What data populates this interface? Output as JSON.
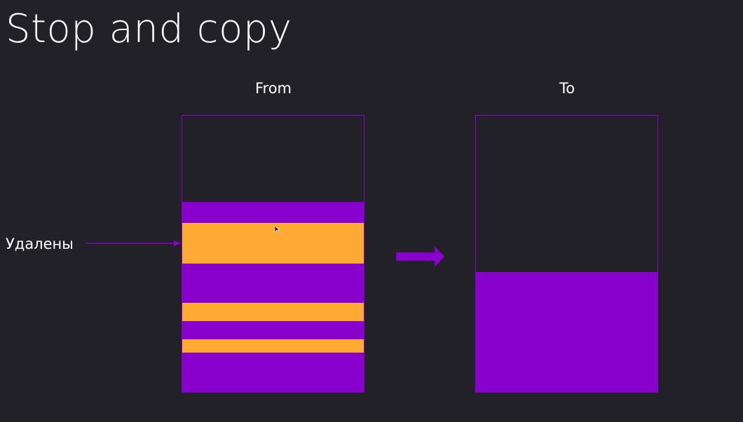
{
  "title": "Stop and copy",
  "from_label": "From",
  "to_label": "To",
  "deleted_label": "Удалены",
  "colors": {
    "background": "#232128",
    "live": "#8800cc",
    "garbage": "#ffaa33",
    "border": "#8a00d6"
  }
}
